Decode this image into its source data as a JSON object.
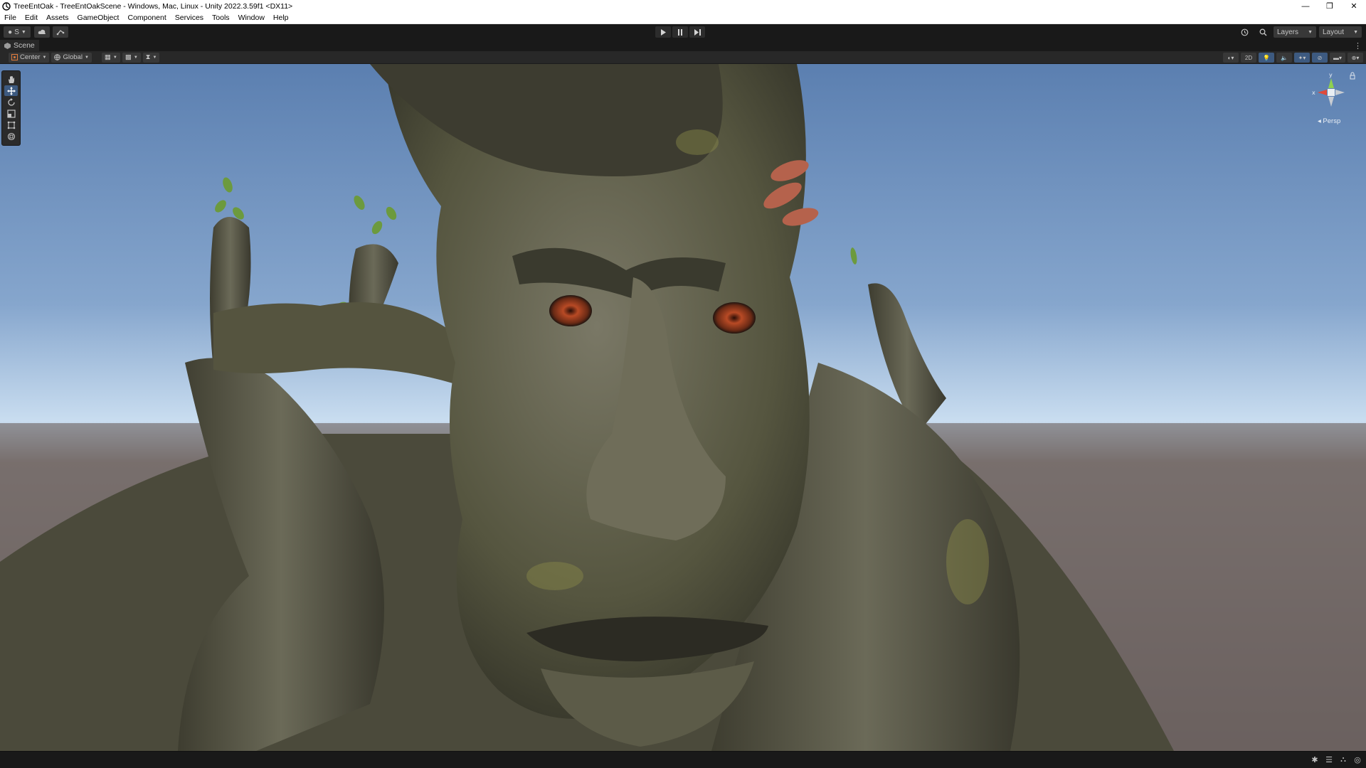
{
  "window": {
    "title": "TreeEntOak - TreeEntOakScene - Windows, Mac, Linux - Unity 2022.3.59f1 <DX11>",
    "minimize_glyph": "—",
    "restore_glyph": "❐",
    "close_glyph": "✕"
  },
  "menu": [
    "File",
    "Edit",
    "Assets",
    "GameObject",
    "Component",
    "Services",
    "Tools",
    "Window",
    "Help"
  ],
  "toolbar": {
    "account_label": "S",
    "layers_label": "Layers",
    "layout_label": "Layout"
  },
  "scene_tab": {
    "label": "Scene"
  },
  "scene_toolbar": {
    "pivot_label": "Center",
    "space_label": "Global",
    "mode_2d_label": "2D"
  },
  "gizmo": {
    "persp_label": "Persp",
    "x_label": "x",
    "y_label": "y"
  },
  "colors": {
    "sky_top": "#5b7fb0",
    "sky_horizon": "#c9ddf0",
    "ground": "#6e6462",
    "bark": "#5a5a4a",
    "editor_bg": "#191919",
    "accent": "#3d5a80"
  },
  "icons": {
    "tools": [
      "hand-tool-icon",
      "move-tool-icon",
      "rotate-tool-icon",
      "scale-tool-icon",
      "rect-tool-icon",
      "transform-tool-icon"
    ]
  }
}
